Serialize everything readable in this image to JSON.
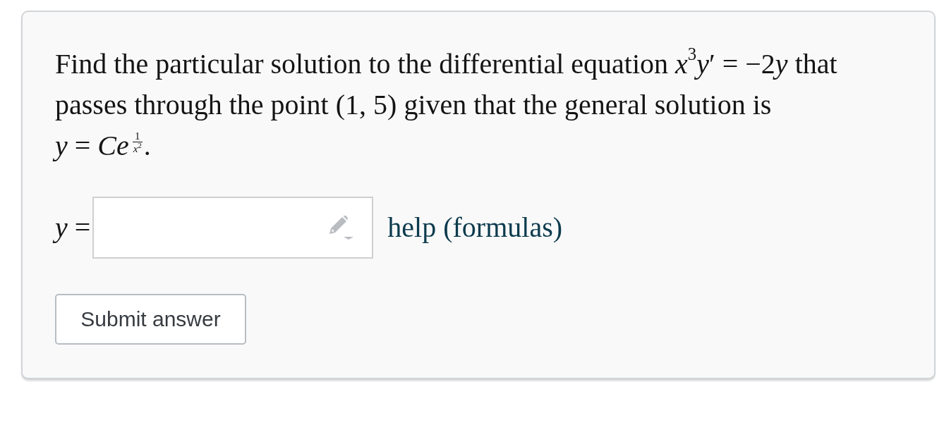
{
  "problem": {
    "lines": [
      [
        {
          "kind": "text",
          "text": "Find the particular solution to the differential equation "
        },
        {
          "kind": "math",
          "text": "*x*$^{3}$*y*′ = −2"
        },
        {
          "kind": "math",
          "text": "*y*"
        },
        {
          "kind": "text",
          "text": " that"
        }
      ],
      [
        {
          "kind": "text",
          "text": "passes through the point "
        },
        {
          "kind": "math",
          "text": "(1, 5)"
        },
        {
          "kind": "text",
          "text": " given that the general solution is"
        }
      ],
      [
        {
          "kind": "math",
          "text": "*y* = *Ce*"
        },
        {
          "kind": "exponent_fraction",
          "numerator": "1",
          "denominator": "*x*$^{2}$"
        },
        {
          "kind": "text",
          "text": "."
        }
      ]
    ]
  },
  "answer": {
    "label": "*y* =",
    "help_link": "help (formulas)"
  },
  "submit_button": "Submit answer"
}
